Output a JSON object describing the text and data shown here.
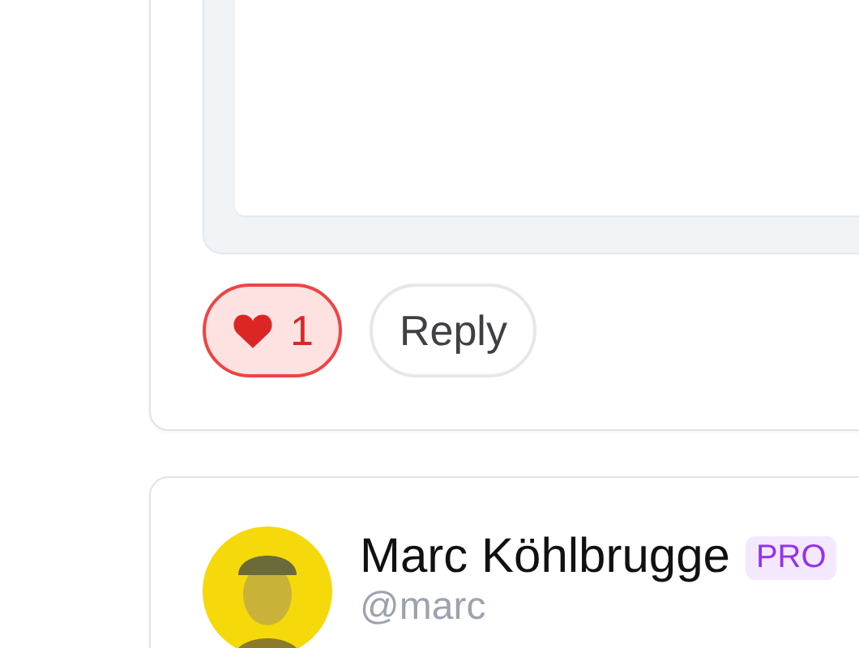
{
  "comment": {
    "like": {
      "count": "1",
      "liked": true
    },
    "reply": {
      "label": "Reply"
    }
  },
  "next_comment": {
    "author": "Marc Köhlbrugge",
    "badge": "PRO",
    "handle": "@marc"
  }
}
